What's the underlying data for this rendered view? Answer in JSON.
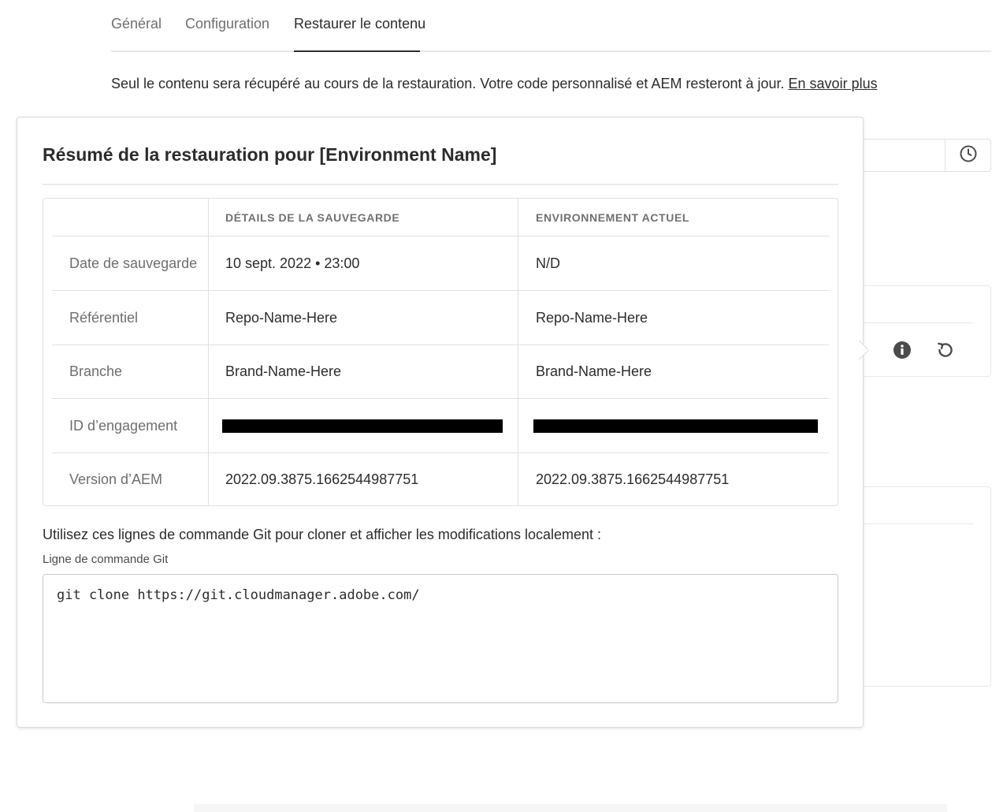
{
  "tabs": [
    {
      "label": "Général",
      "active": false
    },
    {
      "label": "Configuration",
      "active": false
    },
    {
      "label": "Restaurer le contenu",
      "active": true
    }
  ],
  "info": {
    "text": "Seul le contenu sera récupéré au cours de la restauration. Votre code personnalisé et AEM resteront à jour.",
    "link": "En savoir plus"
  },
  "background": {
    "history_icon": "clock-icon",
    "card_icons": [
      "info-icon",
      "restore-icon"
    ]
  },
  "popover": {
    "title": "Résumé de la restauration pour [Environment Name]",
    "table": {
      "headers": [
        "",
        "DÉTAILS DE LA SAUVEGARDE",
        "ENVIRONNEMENT ACTUEL"
      ],
      "rows": [
        {
          "label": "Date de sauvegarde",
          "backup": "10 sept. 2022 • 23:00",
          "current": "N/D"
        },
        {
          "label": "Référentiel",
          "backup": "Repo-Name-Here",
          "current": "Repo-Name-Here"
        },
        {
          "label": "Branche",
          "backup": "Brand-Name-Here",
          "current": "Brand-Name-Here"
        },
        {
          "label": "ID d’engagement",
          "backup": null,
          "current": null,
          "redacted": true
        },
        {
          "label": "Version d’AEM",
          "backup": "2022.09.3875.1662544987751",
          "current": "2022.09.3875.1662544987751"
        }
      ]
    },
    "git": {
      "intro": "Utilisez ces lignes de commande Git pour cloner et afficher les modifications localement :",
      "label": "Ligne de commande Git",
      "command": "git clone https://git.cloudmanager.adobe.com/"
    }
  },
  "colors": {
    "text": "#2c2c2c",
    "muted": "#6e6e6e",
    "border": "#e1e1e1",
    "redaction": "#000000"
  }
}
